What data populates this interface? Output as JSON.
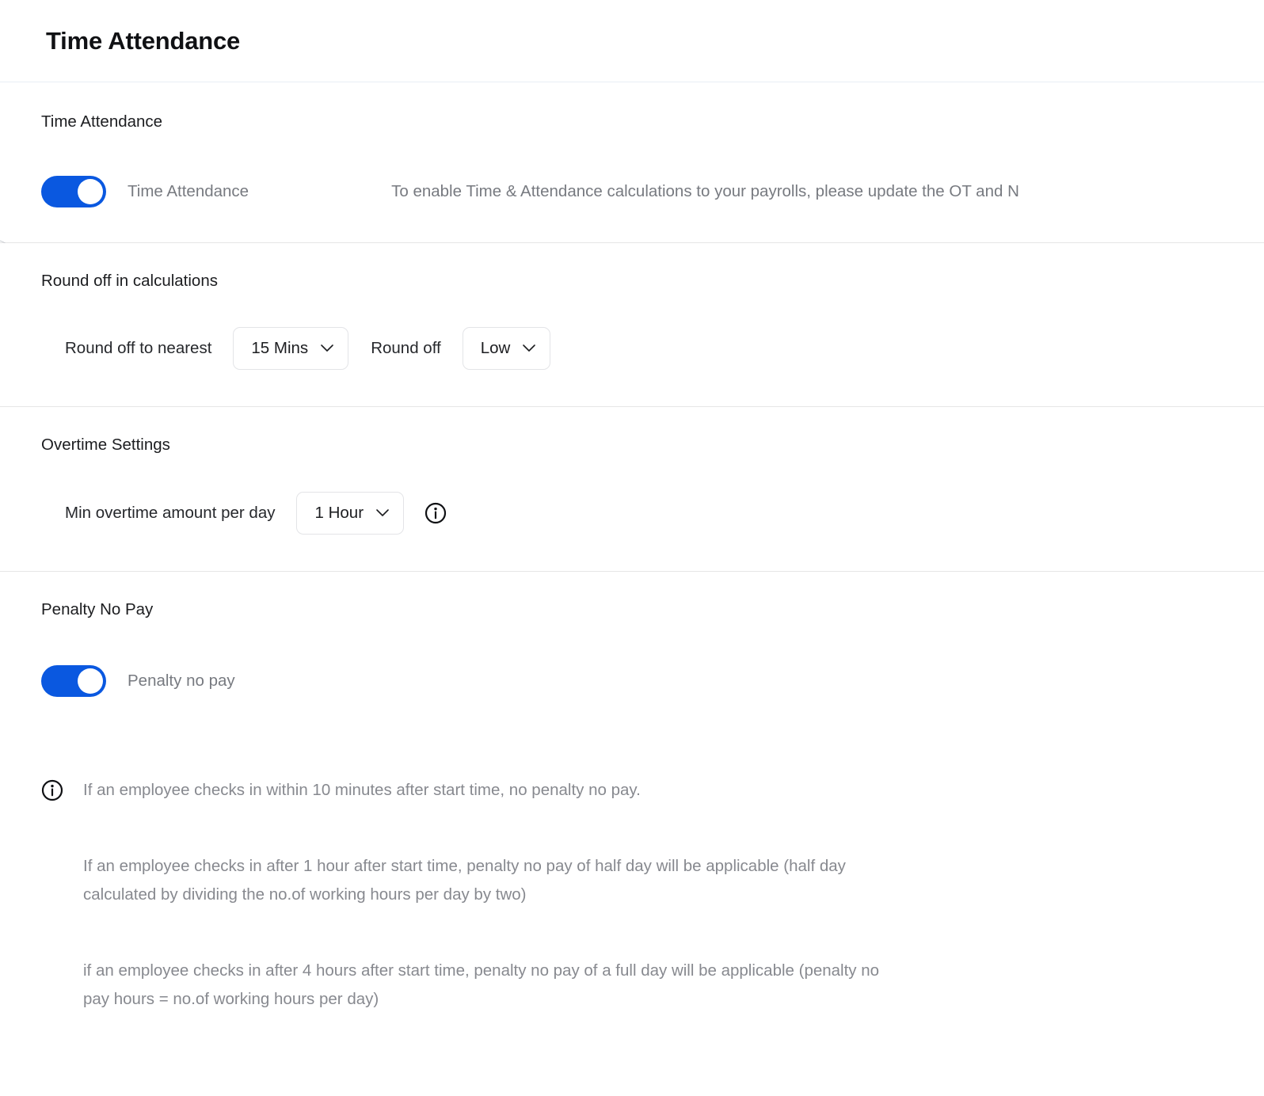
{
  "header": {
    "title": "Time Attendance"
  },
  "sections": {
    "attendance": {
      "title": "Time Attendance",
      "toggle_label": "Time Attendance",
      "toggle_state": "on",
      "description": "To enable Time & Attendance calculations to your payrolls, please update the OT and N"
    },
    "roundoff": {
      "title": "Round off in calculations",
      "nearest_label": "Round off to nearest",
      "nearest_value": "15 Mins",
      "direction_label": "Round off",
      "direction_value": "Low"
    },
    "overtime": {
      "title": "Overtime Settings",
      "min_overtime_label": "Min overtime amount per day",
      "min_overtime_value": "1 Hour",
      "info_icon": "info-icon"
    },
    "penalty": {
      "title": "Penalty No Pay",
      "toggle_label": "Penalty no pay",
      "toggle_state": "on"
    }
  },
  "notes": [
    {
      "icon": "info-icon",
      "text": "If an employee checks in within 10 minutes after start time, no penalty no pay."
    },
    {
      "icon": "none",
      "text": "If an employee checks in after 1 hour after start time, penalty no pay of half day will be applicable (half day calculated by dividing the no.of working hours per day by two)"
    },
    {
      "icon": "none",
      "text": "if an employee checks in after 4 hours after start time, penalty no pay of a full day will be applicable (penalty no pay hours = no.of working hours per day)"
    }
  ],
  "colors": {
    "toggle_on": "#0a58e0",
    "divider": "#e6e6e6",
    "header_divider": "#e9eef4",
    "muted_text": "#87898f",
    "select_border": "#e3e4e7"
  }
}
